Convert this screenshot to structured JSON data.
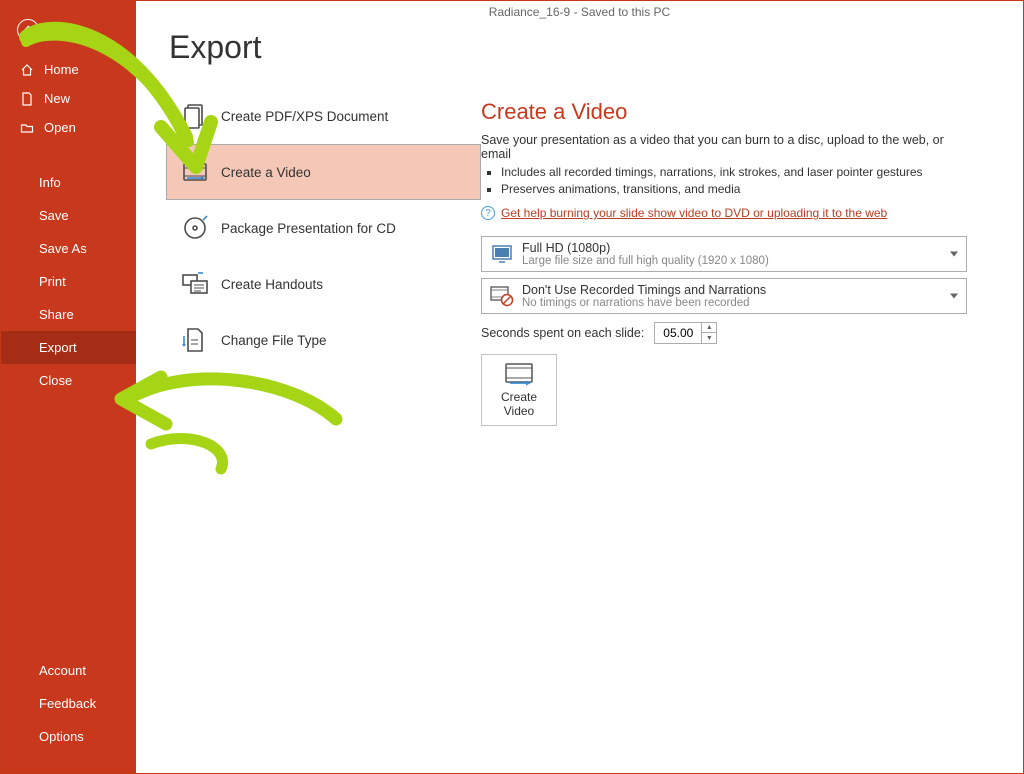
{
  "titlebar": "Radiance_16-9  -  Saved to this PC",
  "page_title": "Export",
  "sidebar": {
    "main": [
      {
        "name": "home",
        "label": "Home"
      },
      {
        "name": "new",
        "label": "New"
      },
      {
        "name": "open",
        "label": "Open"
      }
    ],
    "sub": [
      {
        "name": "info",
        "label": "Info"
      },
      {
        "name": "save",
        "label": "Save"
      },
      {
        "name": "saveas",
        "label": "Save As"
      },
      {
        "name": "print",
        "label": "Print"
      },
      {
        "name": "share",
        "label": "Share"
      },
      {
        "name": "export",
        "label": "Export",
        "active": true
      },
      {
        "name": "close",
        "label": "Close"
      }
    ],
    "bottom": [
      {
        "name": "account",
        "label": "Account"
      },
      {
        "name": "feedback",
        "label": "Feedback"
      },
      {
        "name": "options",
        "label": "Options"
      }
    ]
  },
  "options": [
    {
      "name": "pdf",
      "label": "Create PDF/XPS Document"
    },
    {
      "name": "video",
      "label": "Create a Video",
      "selected": true
    },
    {
      "name": "cd",
      "label": "Package Presentation for CD"
    },
    {
      "name": "handouts",
      "label": "Create Handouts"
    },
    {
      "name": "filetype",
      "label": "Change File Type"
    }
  ],
  "detail": {
    "title": "Create a Video",
    "desc": "Save your presentation as a video that you can burn to a disc, upload to the web, or email",
    "bullets": [
      "Includes all recorded timings, narrations, ink strokes, and laser pointer gestures",
      "Preserves animations, transitions, and media"
    ],
    "help_link": "Get help burning your slide show video to DVD or uploading it to the web",
    "combo1": {
      "title": "Full HD (1080p)",
      "sub": "Large file size and full high quality (1920 x 1080)"
    },
    "combo2": {
      "title": "Don't Use Recorded Timings and Narrations",
      "sub": "No timings or narrations have been recorded"
    },
    "seconds_label": "Seconds spent on each slide:",
    "seconds_value": "05.00",
    "create_btn": "Create\nVideo"
  }
}
